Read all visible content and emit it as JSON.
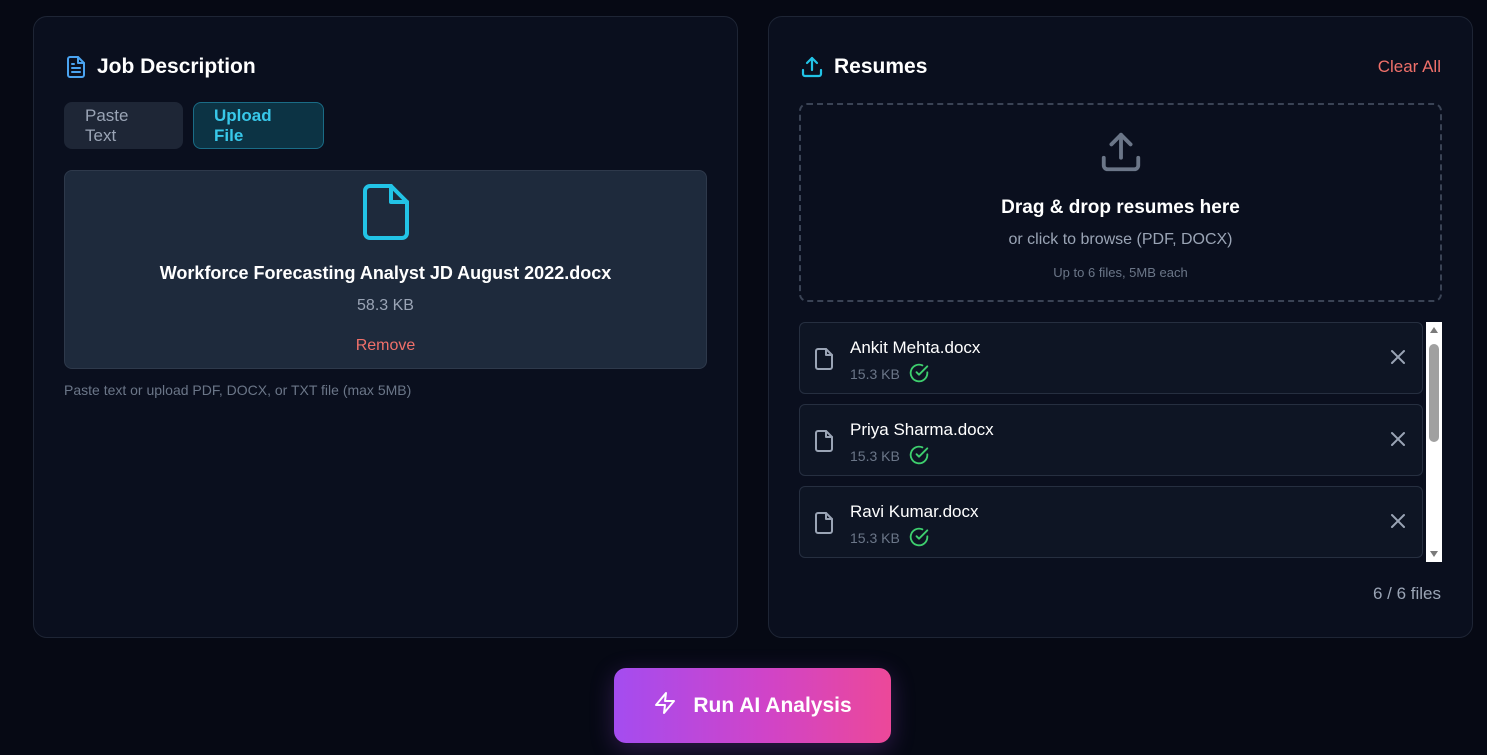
{
  "job_description": {
    "title": "Job Description",
    "title_icon": "document-icon",
    "tabs": [
      {
        "label": "Paste Text",
        "active": false
      },
      {
        "label": "Upload File",
        "active": true
      }
    ],
    "uploaded_file": {
      "name": "Workforce Forecasting Analyst JD August 2022.docx",
      "size": "58.3 KB",
      "remove_label": "Remove"
    },
    "hint": "Paste text or upload PDF, DOCX, or TXT file (max 5MB)"
  },
  "resumes": {
    "title": "Resumes",
    "title_icon": "upload-icon",
    "clear_all_label": "Clear All",
    "dropzone": {
      "title": "Drag & drop resumes here",
      "subtitle": "or click to browse (PDF, DOCX)",
      "limit": "Up to 6 files, 5MB each"
    },
    "files": [
      {
        "name": "Ankit Mehta.docx",
        "size": "15.3 KB",
        "status": "uploaded"
      },
      {
        "name": "Priya Sharma.docx",
        "size": "15.3 KB",
        "status": "uploaded"
      },
      {
        "name": "Ravi Kumar.docx",
        "size": "15.3 KB",
        "status": "uploaded"
      }
    ],
    "file_count": "6 / 6 files"
  },
  "run_button": {
    "label": "Run AI Analysis",
    "icon": "lightning-icon"
  },
  "colors": {
    "background": "#060914",
    "panel": "#0a0f1e",
    "accent_cyan": "#38c8ea",
    "danger": "#f0706a",
    "success": "#3ecf6e",
    "gradient_start": "#a44cf0",
    "gradient_end": "#ec4899"
  }
}
